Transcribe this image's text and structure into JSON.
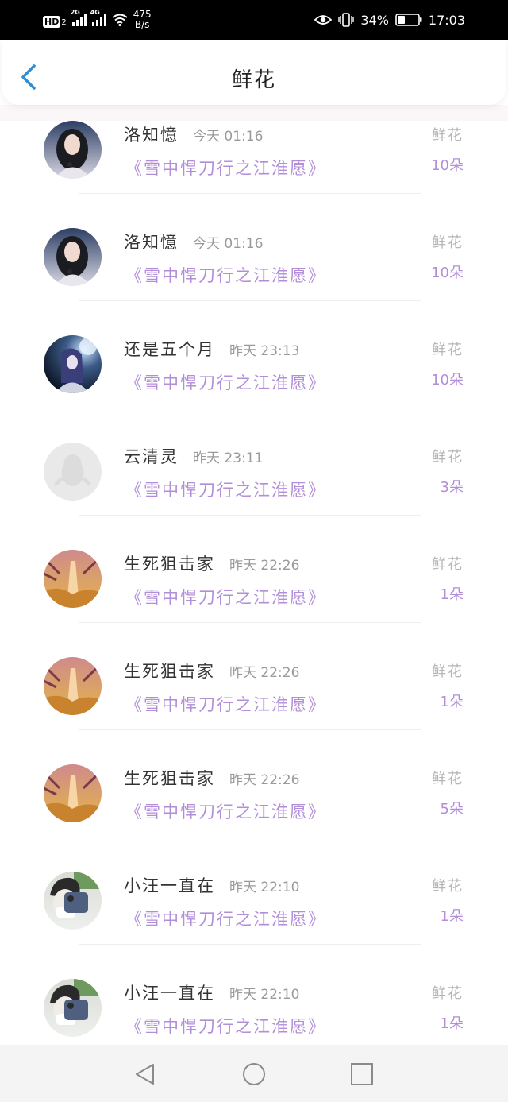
{
  "status_bar": {
    "hd_label": "HD",
    "hd_sub": "2",
    "net1": "2G",
    "net2": "4G",
    "speed_value": "475",
    "speed_unit": "B/s",
    "battery_percent": "34%",
    "time": "17:03"
  },
  "header": {
    "title": "鲜花",
    "back_icon": "chevron-left-icon",
    "accent": "#2f8ed6"
  },
  "rows": [
    {
      "name": "洛知憶",
      "time": "今天 01:16",
      "book": "《雪中悍刀行之江淮愿》",
      "type": "鲜花",
      "count": "10朵",
      "avatar": "avatar-portrait-1"
    },
    {
      "name": "洛知憶",
      "time": "今天 01:16",
      "book": "《雪中悍刀行之江淮愿》",
      "type": "鲜花",
      "count": "10朵",
      "avatar": "avatar-portrait-1"
    },
    {
      "name": "还是五个月",
      "time": "昨天 23:13",
      "book": "《雪中悍刀行之江淮愿》",
      "type": "鲜花",
      "count": "10朵",
      "avatar": "avatar-anime-night"
    },
    {
      "name": "云清灵",
      "time": "昨天 23:11",
      "book": "《雪中悍刀行之江淮愿》",
      "type": "鲜花",
      "count": "3朵",
      "avatar": "avatar-default-penguin"
    },
    {
      "name": "生死狙击家",
      "time": "昨天 22:26",
      "book": "《雪中悍刀行之江淮愿》",
      "type": "鲜花",
      "count": "1朵",
      "avatar": "avatar-sunset-tower"
    },
    {
      "name": "生死狙击家",
      "time": "昨天 22:26",
      "book": "《雪中悍刀行之江淮愿》",
      "type": "鲜花",
      "count": "1朵",
      "avatar": "avatar-sunset-tower"
    },
    {
      "name": "生死狙击家",
      "time": "昨天 22:26",
      "book": "《雪中悍刀行之江淮愿》",
      "type": "鲜花",
      "count": "5朵",
      "avatar": "avatar-sunset-tower"
    },
    {
      "name": "小汪一直在",
      "time": "昨天 22:10",
      "book": "《雪中悍刀行之江淮愿》",
      "type": "鲜花",
      "count": "1朵",
      "avatar": "avatar-selfie-phone"
    },
    {
      "name": "小汪一直在",
      "time": "昨天 22:10",
      "book": "《雪中悍刀行之江淮愿》",
      "type": "鲜花",
      "count": "1朵",
      "avatar": "avatar-selfie-phone"
    }
  ],
  "navbar": {
    "back_icon": "nav-back-triangle-icon",
    "home_icon": "nav-home-circle-icon",
    "recents_icon": "nav-recents-square-icon"
  }
}
